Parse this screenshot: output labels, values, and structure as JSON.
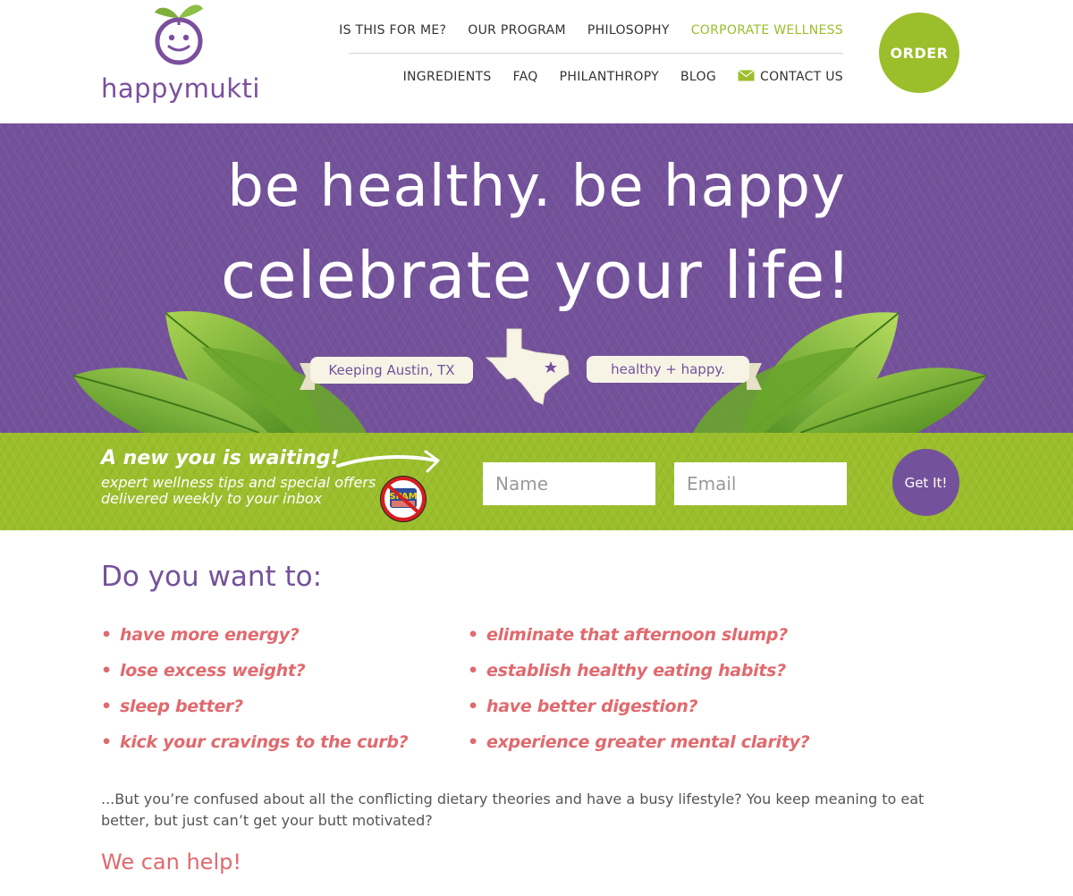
{
  "brand": {
    "name": "happymukti",
    "primary": "#74529b",
    "accent": "#9bbe2b",
    "highlight": "#e06a6e"
  },
  "nav": {
    "top": [
      {
        "label": "IS THIS FOR ME?",
        "active": false
      },
      {
        "label": "OUR PROGRAM",
        "active": false
      },
      {
        "label": "PHILOSOPHY",
        "active": false
      },
      {
        "label": "CORPORATE WELLNESS",
        "active": true
      }
    ],
    "bottom": [
      {
        "label": "INGREDIENTS"
      },
      {
        "label": "FAQ"
      },
      {
        "label": "PHILANTHROPY"
      },
      {
        "label": "BLOG"
      },
      {
        "label": "CONTACT US",
        "icon": "mail-icon"
      }
    ],
    "order_label": "ORDER"
  },
  "hero": {
    "line1": "be healthy. be happy",
    "line2": "celebrate your life!",
    "banner_left": "Keeping Austin, TX",
    "banner_right": "healthy + happy.",
    "icon": "texas-map-icon"
  },
  "signup": {
    "headline": "A new you is waiting!",
    "subtext": "expert wellness tips and special offers delivered weekly to your inbox",
    "name_placeholder": "Name",
    "email_placeholder": "Email",
    "button_label": "Get It!",
    "badge": "no-spam-icon",
    "badge_text": "SPAM"
  },
  "content": {
    "heading": "Do you want to:",
    "left_items": [
      "have more energy?",
      "lose excess weight?",
      "sleep better?",
      "kick your cravings to the curb?"
    ],
    "right_items": [
      "eliminate that afternoon slump?",
      "establish healthy eating habits?",
      "have better digestion?",
      "experience greater mental clarity?"
    ],
    "paragraph": "...But you’re confused about all the conflicting dietary theories and have a busy lifestyle? You keep meaning to eat better, but just can’t get your butt motivated?",
    "help": "We can help!"
  }
}
